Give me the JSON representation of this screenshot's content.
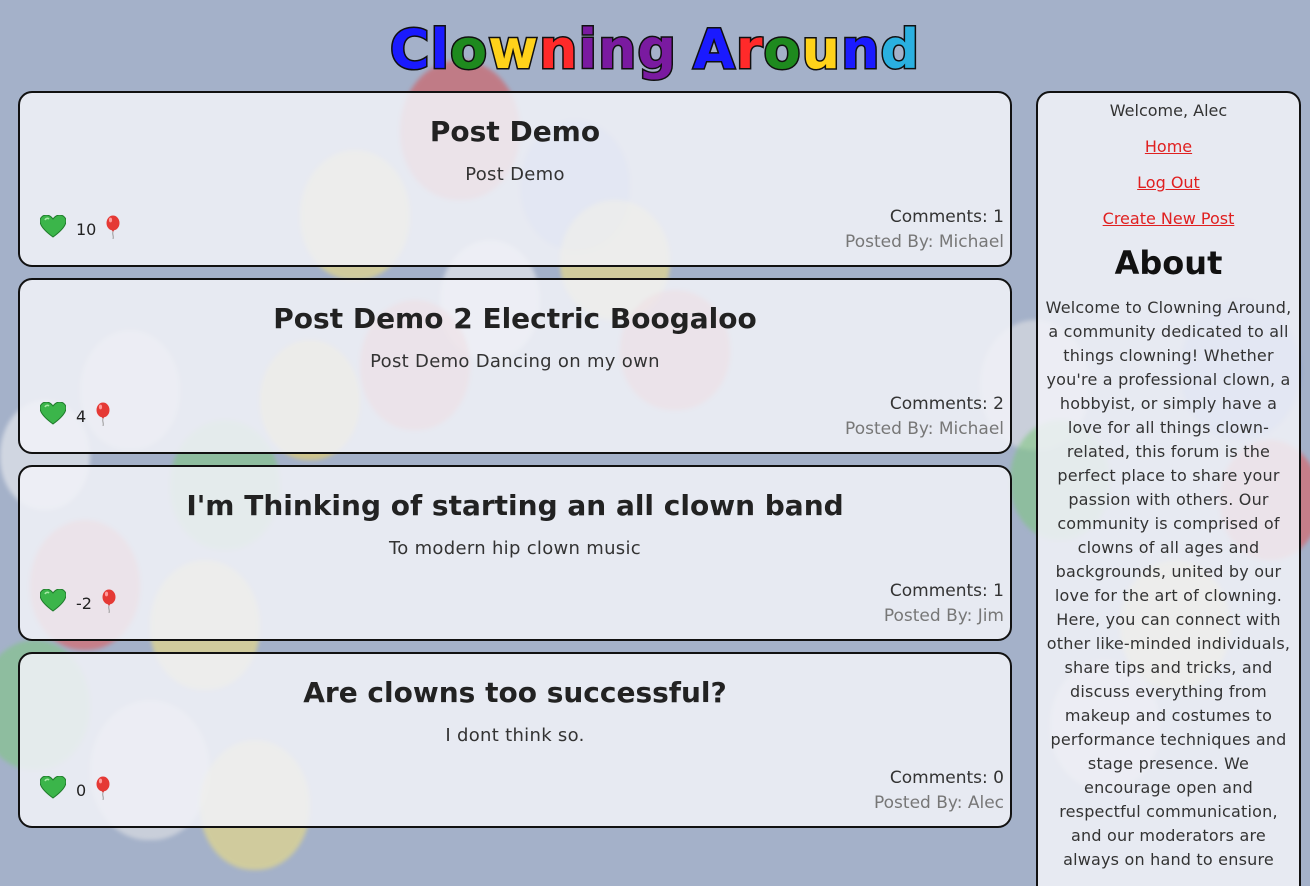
{
  "site": {
    "title_letters": [
      "C",
      "l",
      "o",
      "w",
      "n",
      "i",
      "n",
      "g",
      " ",
      "A",
      "r",
      "o",
      "u",
      "n",
      "d"
    ],
    "title_colors": [
      "#1a1aff",
      "#1a1aff",
      "#1e8a1e",
      "#ffd21a",
      "#ff2a2a",
      "#7a1aa0",
      "#7a1aa0",
      "#7a1aa0",
      " ",
      "#1a1aff",
      "#ff2a2a",
      "#1e8a1e",
      "#ffd21a",
      "#1a1aff",
      "#2ab0e0"
    ]
  },
  "posts": [
    {
      "title": "Post Demo",
      "body": "Post Demo",
      "votes": "10",
      "comments": "Comments: 1",
      "posted_by": "Posted By: Michael"
    },
    {
      "title": "Post Demo 2 Electric Boogaloo",
      "body": "Post Demo Dancing on my own",
      "votes": "4",
      "comments": "Comments: 2",
      "posted_by": "Posted By: Michael"
    },
    {
      "title": "I'm Thinking of starting an all clown band",
      "body": "To modern hip clown music",
      "votes": "-2",
      "comments": "Comments: 1",
      "posted_by": "Posted By: Jim"
    },
    {
      "title": "Are clowns too successful?",
      "body": "I dont think so.",
      "votes": "0",
      "comments": "Comments: 0",
      "posted_by": "Posted By: Alec"
    }
  ],
  "icons": {
    "upvote": "green-heart-icon",
    "downvote": "red-balloon-icon"
  },
  "sidebar": {
    "welcome": "Welcome, Alec",
    "links": [
      "Home",
      "Log Out",
      "Create New Post"
    ],
    "about_heading": "About",
    "about_text": "Welcome to Clowning Around, a community dedicated to all things clowning! Whether you're a professional clown, a hobbyist, or simply have a love for all things clown-related, this forum is the perfect place to share your passion with others. Our community is comprised of clowns of all ages and backgrounds, united by our love for the art of clowning. Here, you can connect with other like-minded individuals, share tips and tricks, and discuss everything from makeup and costumes to performance techniques and stage presence. We encourage open and respectful communication, and our moderators are always on hand to ensure"
  },
  "colors": {
    "link": "#e02020",
    "upvote": "#3bb54a",
    "downvote": "#e53935"
  }
}
